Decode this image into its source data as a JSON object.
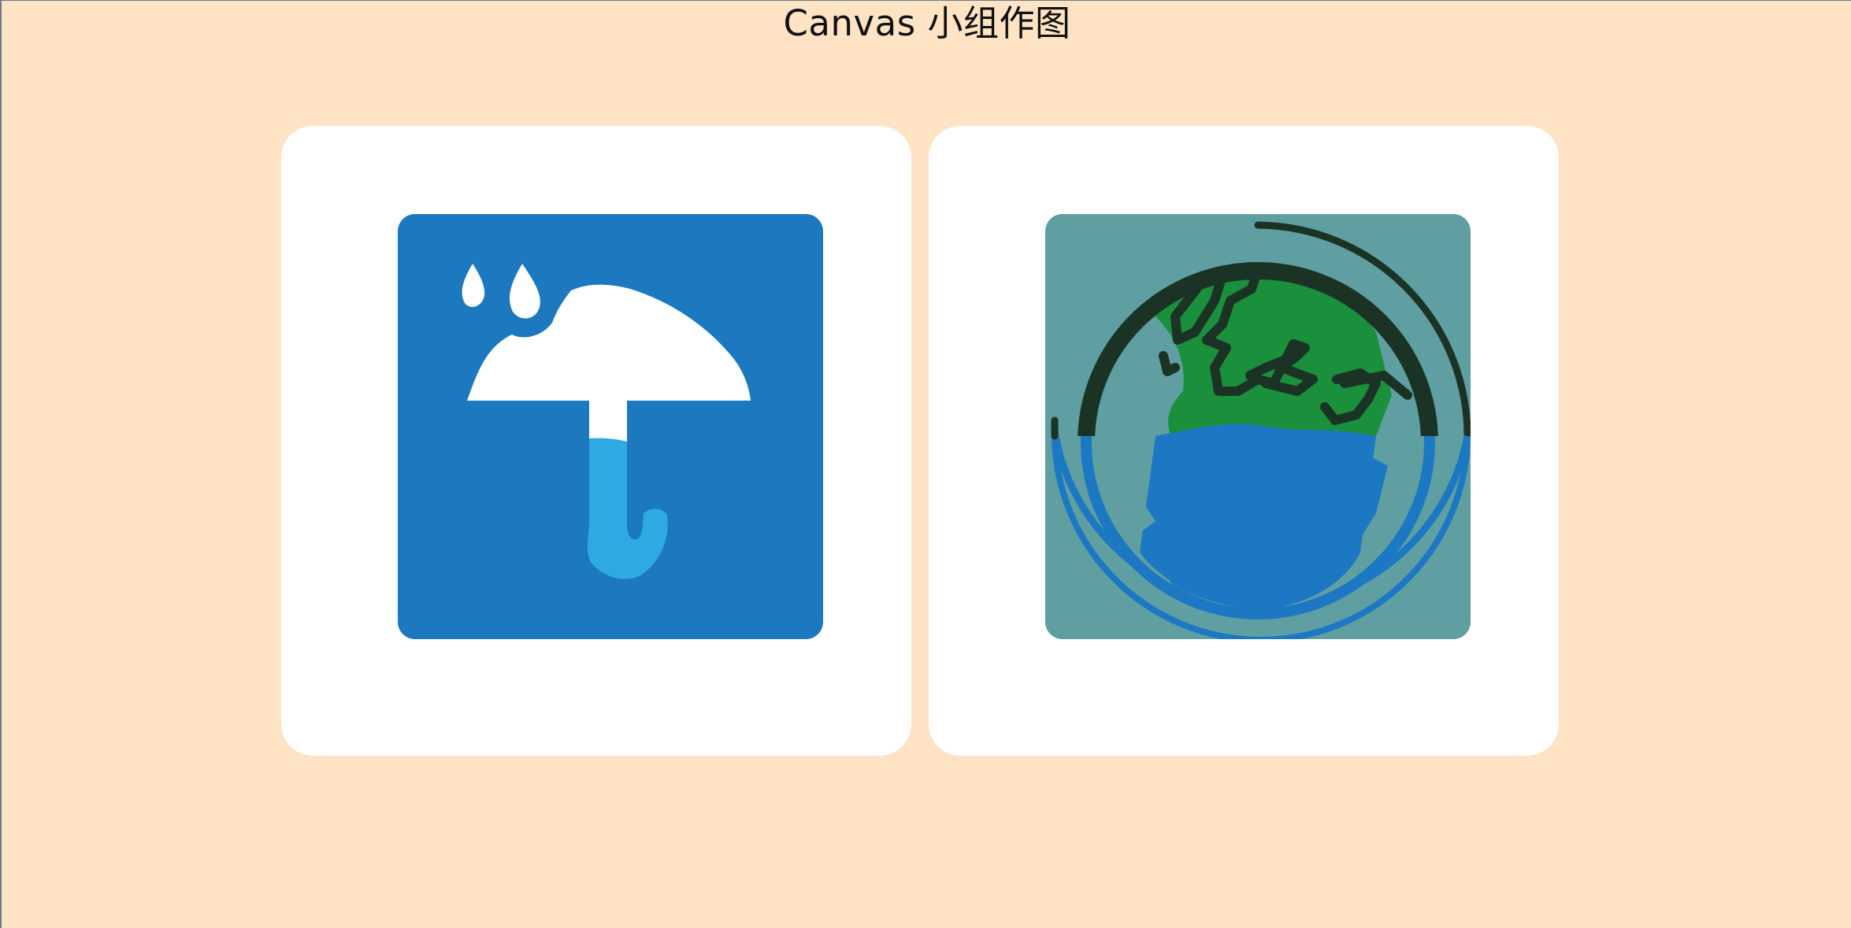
{
  "page": {
    "title": "Canvas 小组作图"
  },
  "colors": {
    "background": "#fee4c4",
    "card": "#ffffff",
    "umbrella_tile": "#1c78bf",
    "umbrella_canopy": "#ffffff",
    "umbrella_handle": "#2ea9e1",
    "globe_tile": "#5f9fa1",
    "globe_land": "#1a8f3c",
    "globe_outline": "#1b3325",
    "globe_water": "#1d78c4"
  },
  "cards": [
    {
      "icon": "umbrella-rain-icon"
    },
    {
      "icon": "earth-globe-icon"
    }
  ]
}
